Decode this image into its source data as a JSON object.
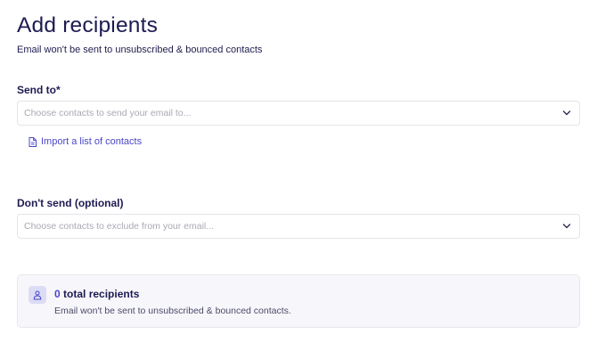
{
  "header": {
    "title": "Add recipients",
    "subtitle": "Email won't be sent to unsubscribed & bounced contacts"
  },
  "send_to": {
    "label": "Send to*",
    "placeholder": "Choose contacts to send your email to...",
    "icon": "chevron-down-icon",
    "import_link": {
      "label": "Import a list of contacts",
      "icon": "file-icon"
    }
  },
  "dont_send": {
    "label": "Don't send (optional)",
    "placeholder": "Choose contacts to exclude from your email...",
    "icon": "chevron-down-icon"
  },
  "summary": {
    "icon": "user-icon",
    "count": "0",
    "count_label": "total recipients",
    "note": "Email won't be sent to unsubscribed & bounced contacts."
  },
  "colors": {
    "title": "#1d1b52",
    "accent": "#4a46c9",
    "placeholder": "#a9a9b6",
    "border": "#e4e4ea",
    "summary_bg": "#f7f7fb",
    "badge_bg": "#dcdcf5"
  }
}
